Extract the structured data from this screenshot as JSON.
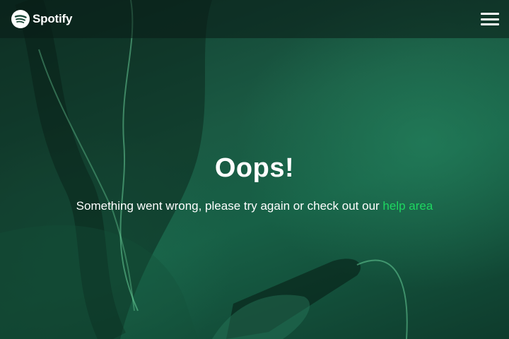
{
  "header": {
    "logo_text": "Spotify",
    "logo_icon": "spotify-logo-icon",
    "menu_icon": "hamburger-menu-icon"
  },
  "main": {
    "title": "Oops!",
    "message_prefix": "Something went wrong, please try again or check out our ",
    "help_link_text": "help area"
  },
  "colors": {
    "accent": "#1ed760",
    "overlay": "#1a5a43",
    "text": "#ffffff"
  }
}
